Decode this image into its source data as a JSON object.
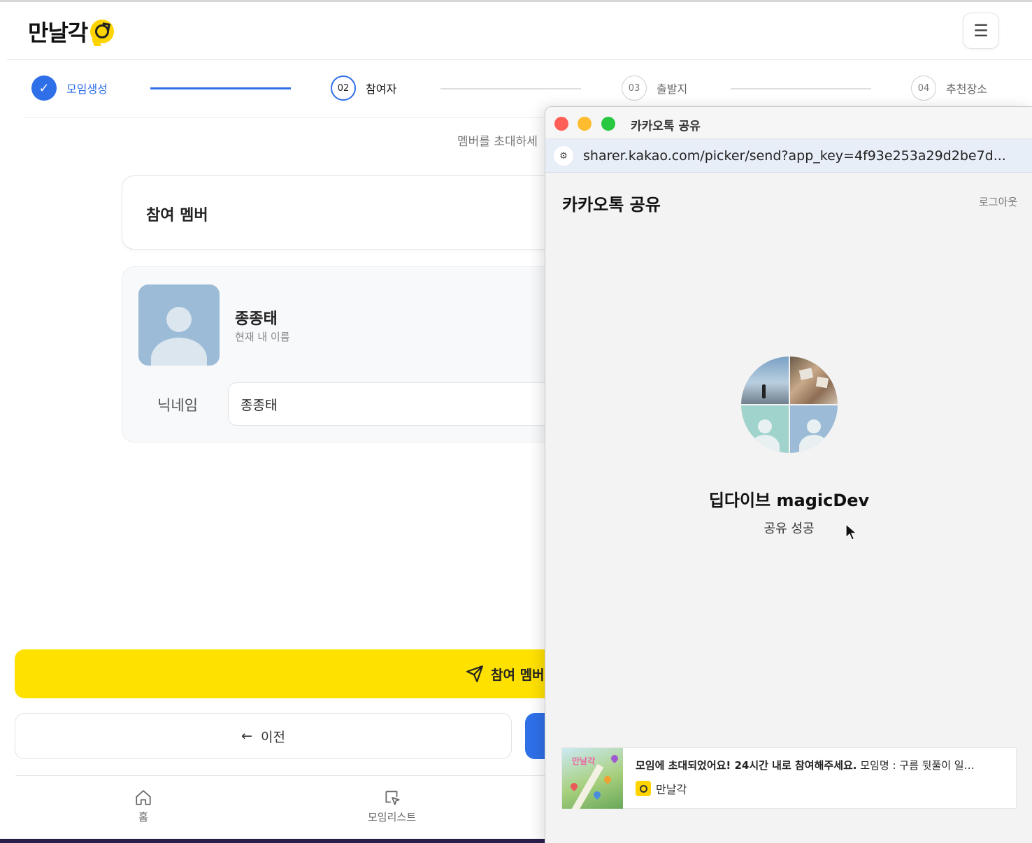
{
  "header": {
    "logo_text": "만날각",
    "menu_icon": "hamburger-icon"
  },
  "steps": [
    {
      "number": "✓",
      "label": "모임생성",
      "state": "done"
    },
    {
      "number": "02",
      "label": "참여자",
      "state": "active"
    },
    {
      "number": "03",
      "label": "출발지",
      "state": "todo"
    },
    {
      "number": "04",
      "label": "추천장소",
      "state": "todo"
    }
  ],
  "main": {
    "invite_text": "멤버를 초대하세",
    "members_card_title": "참여 멤버",
    "me": {
      "name": "종종태",
      "subtitle": "현재 내 이름",
      "nickname_label": "닉네임",
      "nickname_value": "종종태"
    },
    "share_button_label": "참여 멤버",
    "prev_button_label": "이전"
  },
  "bottom_nav": [
    {
      "label": "홈",
      "icon": "home-icon"
    },
    {
      "label": "모임리스트",
      "icon": "cursor-list-icon"
    }
  ],
  "popup": {
    "window_title": "카카오톡 공유",
    "url": "sharer.kakao.com/picker/send?app_key=4f93e253a29d2be7d...",
    "heading": "카카오톡 공유",
    "logout_label": "로그아웃",
    "recipient_name": "딥다이브 magicDev",
    "status": "공유 성공",
    "message": {
      "bold": "모임에 초대되었어요! 24시간 내로 참여해주세요.",
      "rest": " 모임명 : 구름 뒷풀이 일…",
      "app_name": "만날각",
      "thumb_title": "만날각"
    }
  },
  "colors": {
    "primary": "#2f6fe8",
    "kakao_yellow": "#ffe100",
    "close": "#ff5f57",
    "minimize": "#febc2e",
    "maximize": "#28c840"
  }
}
